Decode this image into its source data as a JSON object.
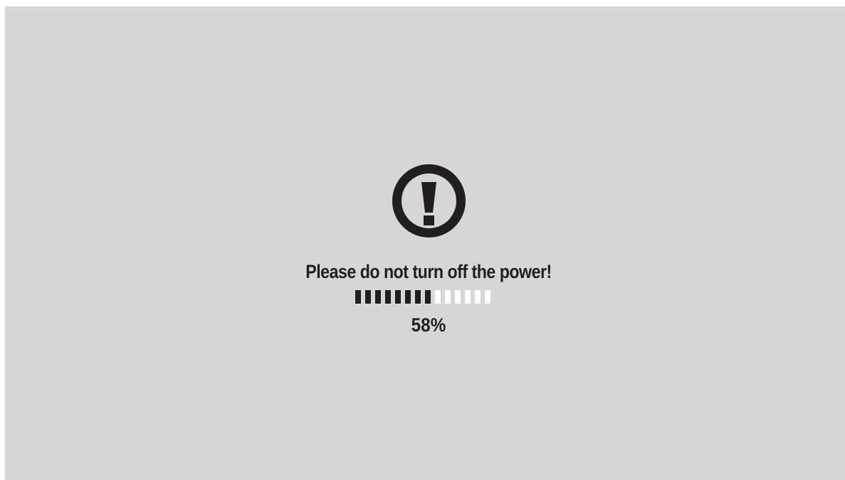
{
  "dialog": {
    "icon": "exclamation-circle-icon",
    "message": "Please do not turn off the power!",
    "progress": {
      "percent_label": "58%",
      "filled_segments": 8,
      "total_segments": 14
    }
  },
  "colors": {
    "background": "#d5d6d8",
    "foreground": "#231f20",
    "empty_segment": "#ffffff"
  }
}
